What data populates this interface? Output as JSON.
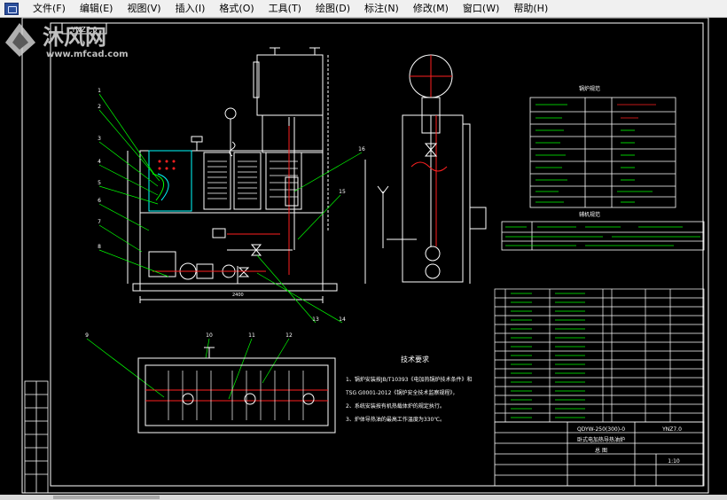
{
  "menu": {
    "items": [
      {
        "label": "文件(F)",
        "name": "menu-file"
      },
      {
        "label": "编辑(E)",
        "name": "menu-edit"
      },
      {
        "label": "视图(V)",
        "name": "menu-view"
      },
      {
        "label": "插入(I)",
        "name": "menu-insert"
      },
      {
        "label": "格式(O)",
        "name": "menu-format"
      },
      {
        "label": "工具(T)",
        "name": "menu-tools"
      },
      {
        "label": "绘图(D)",
        "name": "menu-draw"
      },
      {
        "label": "标注(N)",
        "name": "menu-dimension"
      },
      {
        "label": "修改(M)",
        "name": "menu-modify"
      },
      {
        "label": "窗口(W)",
        "name": "menu-window"
      },
      {
        "label": "帮助(H)",
        "name": "menu-help"
      }
    ]
  },
  "drawing": {
    "title_stamp": "YNZ7.0",
    "tech_title": "技术要求",
    "tech_lines": [
      "1、锅炉安装按JB/T10393《电加热锅炉技术条件》和",
      "TSG G0001-2012《锅炉安全技术监察规程》，",
      "2、系统安装按有机热载体炉的规定执行。",
      "3、炉体导热油的最高工作温度为330℃。"
    ],
    "callouts": [
      "1",
      "2",
      "3",
      "4",
      "5",
      "6",
      "7",
      "8",
      "9",
      "10",
      "11",
      "12",
      "13",
      "14",
      "15",
      "16"
    ],
    "table_title_1": "锅炉规范",
    "table_title_2": "辅机规范",
    "title_block_drawing_no": "QDYW-250(300)-0",
    "title_block_name": "卧式电加热导热油炉",
    "title_block_sub": "总  图",
    "title_block_scale": "1:10",
    "dim_width": "2400",
    "drawing_code_right": "YNZ7.0"
  },
  "watermark": {
    "brand_cn": "沐风网",
    "brand_url": "www.mfcad.com"
  },
  "colors": {
    "menubar_bg": "#f0f0f0",
    "canvas_bg": "#000000",
    "line_white": "#ffffff",
    "line_green": "#00ff00",
    "line_red": "#ff2020",
    "line_yellow": "#ffff00",
    "line_cyan": "#00ffff"
  }
}
